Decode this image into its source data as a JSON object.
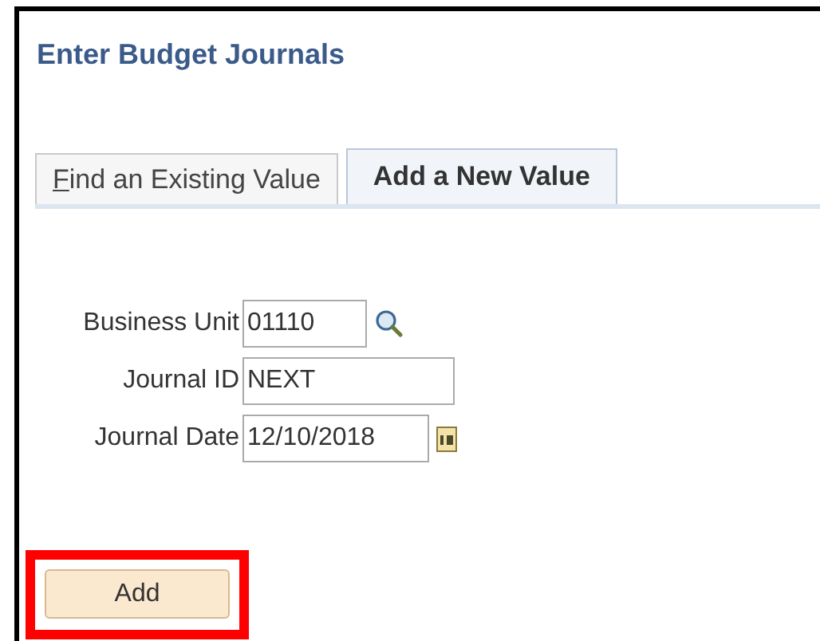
{
  "page_title": "Enter Budget Journals",
  "tabs": [
    {
      "label": "Find an Existing Value",
      "selected": false
    },
    {
      "label": "Add a New Value",
      "selected": true
    }
  ],
  "fields": [
    {
      "label": "Business Unit",
      "value": "01110",
      "kind": "lookup"
    },
    {
      "label": "Journal ID",
      "value": "NEXT",
      "kind": "text"
    },
    {
      "label": "Journal Date",
      "value": "12/10/2018",
      "kind": "date"
    }
  ],
  "add_button": {
    "label": "Add",
    "highlighted": true
  }
}
